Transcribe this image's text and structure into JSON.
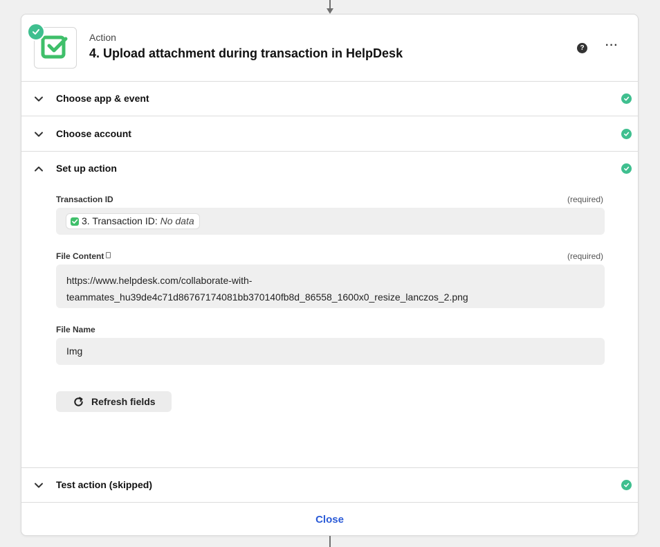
{
  "step": {
    "kind": "Action",
    "title": "4. Upload attachment during transaction in HelpDesk",
    "help_glyph": "?",
    "more_glyph": "···"
  },
  "sections": {
    "app_event": "Choose app & event",
    "account": "Choose account",
    "setup": "Set up action",
    "test": "Test action (skipped)"
  },
  "fields": {
    "transaction_id": {
      "label": "Transaction ID",
      "required": "(required)",
      "pill_text": "3. Transaction ID:",
      "pill_value": "No data"
    },
    "file_content": {
      "label": "File Content",
      "required": "(required)",
      "value_line1": "https://www.helpdesk.com/collaborate-with-",
      "value_line2": "teammates_hu39de4c71d86767174081bb370140fb8d_86558_1600x0_resize_lanczos_2.png"
    },
    "file_name": {
      "label": "File Name",
      "value": "Img"
    }
  },
  "buttons": {
    "refresh": "Refresh fields",
    "close": "Close"
  },
  "colors": {
    "success": "#3fbf8f",
    "brand_green": "#3fbf6a",
    "link_blue": "#2b5bd7"
  },
  "icons": {
    "app": "helpdesk-check-icon",
    "status": "check-circle-icon",
    "collapse": "chevron-down-icon",
    "expand": "chevron-up-icon",
    "refresh": "refresh-icon"
  }
}
